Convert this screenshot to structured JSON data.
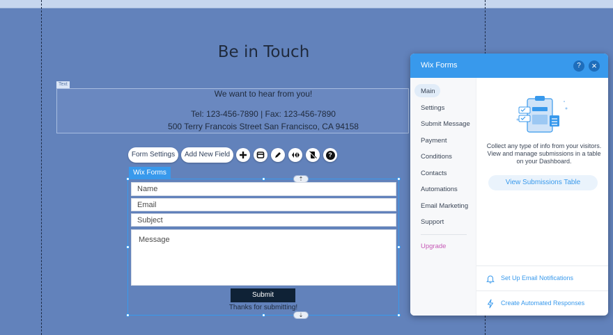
{
  "page": {
    "title": "Be in Touch",
    "text_tag": "Text",
    "text_lines": [
      "We want to hear from you!",
      "Tel: 123-456-7890 | Fax: 123-456-7890",
      "500 Terry Francois Street San Francisco, CA 94158"
    ]
  },
  "toolbar": {
    "form_settings": "Form Settings",
    "add_new_field": "Add New Field",
    "icons": [
      "plus-icon",
      "layout-icon",
      "pen-icon",
      "animation-icon",
      "hide-mobile-icon",
      "help-icon"
    ],
    "help_glyph": "?"
  },
  "form": {
    "tag": "Wix Forms",
    "fields": {
      "name": "Name",
      "email": "Email",
      "subject": "Subject",
      "message": "Message"
    },
    "submit": "Submit",
    "thanks": "Thanks for submitting!"
  },
  "panel": {
    "title": "Wix Forms",
    "help_glyph": "?",
    "close_glyph": "×",
    "nav": [
      "Main",
      "Settings",
      "Submit Message",
      "Payment",
      "Conditions",
      "Contacts",
      "Automations",
      "Email Marketing",
      "Support"
    ],
    "upgrade": "Upgrade",
    "description": "Collect any type of info from your visitors. View and manage submissions in a table on your Dashboard.",
    "view_button": "View Submissions Table",
    "footer": {
      "notifications": "Set Up Email Notifications",
      "responses": "Create Automated Responses"
    }
  },
  "colors": {
    "canvas": "#6282bb",
    "accent": "#3899ec",
    "submit_bg": "#0f2236",
    "upgrade": "#c659b6"
  }
}
